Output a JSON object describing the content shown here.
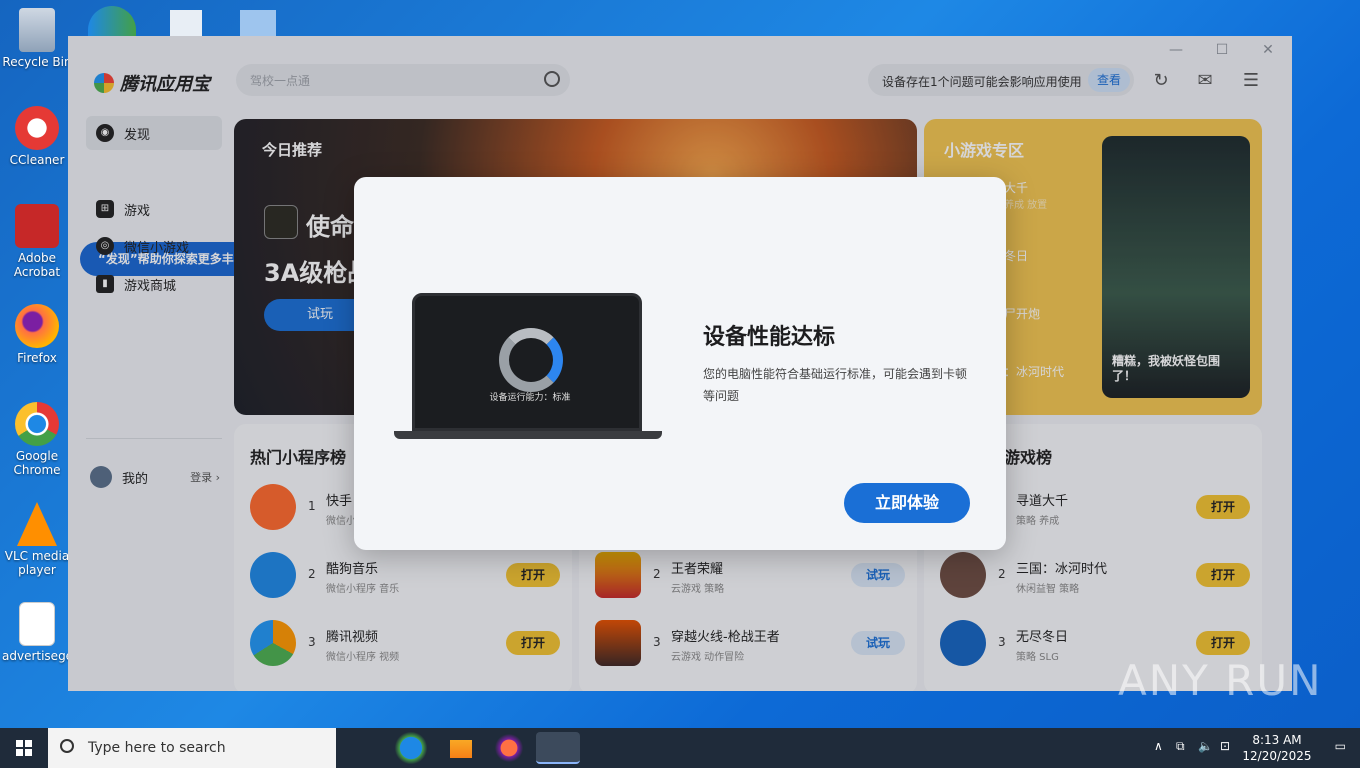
{
  "desktop": {
    "icons": [
      {
        "label": "Recycle Bin"
      },
      {
        "label": "CCleaner"
      },
      {
        "label": "Adobe Acrobat"
      },
      {
        "label": "Firefox"
      },
      {
        "label": "Google Chrome"
      },
      {
        "label": "VLC media player"
      },
      {
        "label": "advertisege..."
      }
    ],
    "watermark": "ANY RUN"
  },
  "app": {
    "name": "腾讯应用宝",
    "search_placeholder": "驾校一点通",
    "notice_text": "设备存在1个问题可能会影响应用使用",
    "notice_button": "查看",
    "window_controls": {
      "minimize": "—",
      "maximize": "☐",
      "close": "✕"
    },
    "sidebar": {
      "items": [
        {
          "label": "发现"
        },
        {
          "label": "游戏"
        },
        {
          "label": "微信小游戏"
        },
        {
          "label": "游戏商城"
        }
      ],
      "tooltip": "“发现”帮助你探索更多丰富内容",
      "mine_label": "我的",
      "login_label": "登录 ›"
    },
    "banner": {
      "tag": "今日推荐",
      "game_name": "使命",
      "subtitle": "3A级枪战",
      "try_button": "试玩"
    },
    "mini_games": {
      "title": "小游戏专区",
      "items": [
        {
          "name": "大千",
          "tags": "养成 放置"
        },
        {
          "name": "冬日",
          "tags": ""
        },
        {
          "name": "尸开炮",
          "tags": ""
        },
        {
          "name": "：冰河时代",
          "tags": ""
        }
      ],
      "art_caption": "糟糕，我被妖怪包围了！"
    },
    "panels": {
      "left": {
        "title": "热门小程序榜",
        "rows": [
          {
            "rank": "1",
            "name": "快手",
            "tags": "微信小",
            "action": ""
          },
          {
            "rank": "2",
            "name": "酷狗音乐",
            "tags": "微信小程序 音乐",
            "action": "打开"
          },
          {
            "rank": "3",
            "name": "腾讯视频",
            "tags": "微信小程序 视频",
            "action": "打开"
          }
        ]
      },
      "middle": {
        "rows": [
          {
            "rank": "2",
            "name": "王者荣耀",
            "tags": "云游戏 策略",
            "action": "试玩"
          },
          {
            "rank": "3",
            "name": "穿越火线-枪战王者",
            "tags": "云游戏 动作冒险",
            "action": "试玩"
          }
        ]
      },
      "right": {
        "title": "游戏榜",
        "rows": [
          {
            "rank": "1",
            "name": "寻道大千",
            "tags": "策略 养成",
            "action": "打开"
          },
          {
            "rank": "2",
            "name": "三国：冰河时代",
            "tags": "休闲益智 策略",
            "action": "打开"
          },
          {
            "rank": "3",
            "name": "无尽冬日",
            "tags": "策略 SLG",
            "action": "打开"
          }
        ]
      }
    }
  },
  "modal": {
    "title": "设备性能达标",
    "description": "您的电脑性能符合基础运行标准，可能会遇到卡顿等问题",
    "gauge_label": "设备运行能力：标准",
    "button": "立即体验"
  },
  "taskbar": {
    "search_placeholder": "Type here to search",
    "time": "8:13 AM",
    "date": "12/20/2025"
  },
  "colors": {
    "accent": "#1a6fd6",
    "open_button": "#f2c230",
    "mini_zone": "#f2c550"
  }
}
